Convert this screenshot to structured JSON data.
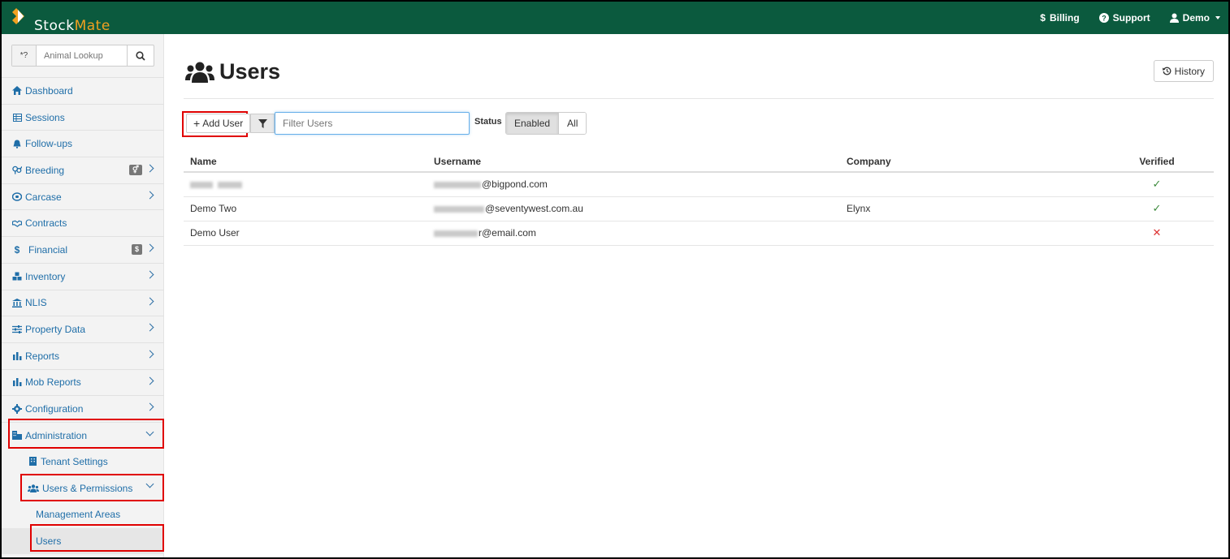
{
  "brand": {
    "name_a": "Stock",
    "name_b": "Mate"
  },
  "topnav": {
    "billing": "Billing",
    "support": "Support",
    "user": "Demo"
  },
  "sidebar": {
    "lookup_prefix": "*?",
    "lookup_placeholder": "Animal Lookup",
    "items": [
      {
        "label": "Dashboard",
        "icon": "home-icon"
      },
      {
        "label": "Sessions",
        "icon": "table-icon"
      },
      {
        "label": "Follow-ups",
        "icon": "bell-icon"
      },
      {
        "label": "Breeding",
        "icon": "venus-mars-icon",
        "badge_icon": "venus-mars-icon"
      },
      {
        "label": "Carcase",
        "icon": "pie-icon"
      },
      {
        "label": "Contracts",
        "icon": "handshake-icon"
      },
      {
        "label": "Financial",
        "icon": "dollar-icon",
        "badge": "$"
      },
      {
        "label": "Inventory",
        "icon": "cubes-icon"
      },
      {
        "label": "NLIS",
        "icon": "bank-icon"
      },
      {
        "label": "Property Data",
        "icon": "sliders-icon"
      },
      {
        "label": "Reports",
        "icon": "bar-chart-icon"
      },
      {
        "label": "Mob Reports",
        "icon": "bar-chart-icon"
      },
      {
        "label": "Configuration",
        "icon": "gear-icon"
      },
      {
        "label": "Administration",
        "icon": "building-icon"
      },
      {
        "label": "Tenant Settings",
        "icon": "building-icon"
      },
      {
        "label": "Users & Permissions",
        "icon": "users-icon"
      },
      {
        "label": "Management Areas"
      },
      {
        "label": "Users"
      }
    ]
  },
  "page": {
    "title": "Users",
    "history_label": "History"
  },
  "toolbar": {
    "add_label": "Add User",
    "filter_placeholder": "Filter Users",
    "status_label": "Status",
    "status_options": [
      "Enabled",
      "All"
    ],
    "status_selected": "Enabled"
  },
  "table": {
    "headers": [
      "Name",
      "Username",
      "Company",
      "Verified"
    ],
    "rows": [
      {
        "name": "",
        "username_suffix": "@bigpond.com",
        "company": "",
        "verified": "✓"
      },
      {
        "name": "Demo Two",
        "username_suffix": "@seventywest.com.au",
        "company": "Elynx",
        "verified": "✓"
      },
      {
        "name": "Demo User",
        "username_suffix": "r@email.com",
        "company": "",
        "verified": "✕"
      }
    ]
  },
  "colors": {
    "topbar": "#0b5a3e",
    "brand_accent": "#f0a020",
    "nav_link": "#1f6ea8",
    "highlight": "#e00000"
  }
}
